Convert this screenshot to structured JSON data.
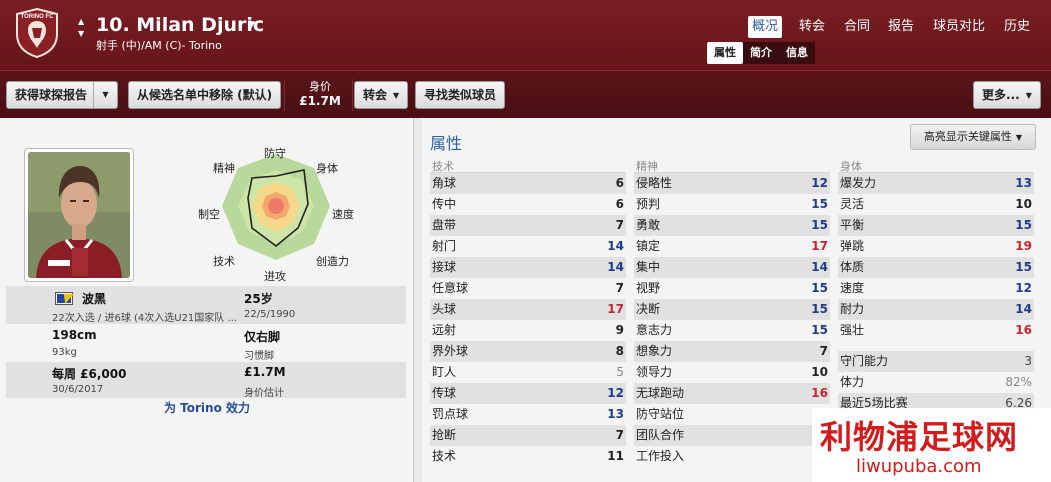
{
  "header": {
    "club_crest_text": "TORINO FC",
    "player_name": "10. Milan Djuric",
    "player_position": "射手 (中)/AM (C)- Torino",
    "nav": [
      "概况",
      "转会",
      "合同",
      "报告",
      "球员对比",
      "历史"
    ],
    "subnav": [
      "属性",
      "简介",
      "信息"
    ]
  },
  "toolbar": {
    "scout_report": "获得球探报告",
    "remove_shortlist": "从候选名单中移除 (默认)",
    "value_label": "身价",
    "value": "£1.7M",
    "transfer": "转会",
    "find_similar": "寻找类似球员",
    "more": "更多..."
  },
  "radar_labels": {
    "defending": "防守",
    "physical": "身体",
    "speed": "速度",
    "creativity": "创造力",
    "attacking": "进攻",
    "technique": "技术",
    "aerial": "制空",
    "mental": "精神"
  },
  "info": {
    "nation": "波黑",
    "caps": "22次入选 / 进6球 (4次入选U21国家队 ...",
    "age": "25岁",
    "dob": "22/5/1990",
    "height": "198cm",
    "weight": "93kg",
    "foot": "仅右脚",
    "foot_label": "习惯脚",
    "wage": "每周 £6,000",
    "contract_end": "30/6/2017",
    "value": "£1.7M",
    "value_label": "身价估计",
    "plays_for": "为 Torino 效力"
  },
  "attributes": {
    "title": "属性",
    "highlight_button": "高亮显示关键属性",
    "technical": {
      "label": "技术",
      "items": [
        {
          "name": "角球",
          "value": "6",
          "color": "dark"
        },
        {
          "name": "传中",
          "value": "6",
          "color": "dark"
        },
        {
          "name": "盘带",
          "value": "7",
          "color": "dark"
        },
        {
          "name": "射门",
          "value": "14",
          "color": "blue"
        },
        {
          "name": "接球",
          "value": "14",
          "color": "blue"
        },
        {
          "name": "任意球",
          "value": "7",
          "color": "dark"
        },
        {
          "name": "头球",
          "value": "17",
          "color": "red"
        },
        {
          "name": "远射",
          "value": "9",
          "color": "dark"
        },
        {
          "name": "界外球",
          "value": "8",
          "color": "dark"
        },
        {
          "name": "盯人",
          "value": "5",
          "color": "grey"
        },
        {
          "name": "传球",
          "value": "12",
          "color": "blue"
        },
        {
          "name": "罚点球",
          "value": "13",
          "color": "blue"
        },
        {
          "name": "抢断",
          "value": "7",
          "color": "dark"
        },
        {
          "name": "技术",
          "value": "11",
          "color": "dark"
        }
      ]
    },
    "mental": {
      "label": "精神",
      "items": [
        {
          "name": "侵略性",
          "value": "12",
          "color": "blue"
        },
        {
          "name": "预判",
          "value": "15",
          "color": "blue"
        },
        {
          "name": "勇敢",
          "value": "15",
          "color": "blue"
        },
        {
          "name": "镇定",
          "value": "17",
          "color": "red"
        },
        {
          "name": "集中",
          "value": "14",
          "color": "blue"
        },
        {
          "name": "视野",
          "value": "15",
          "color": "blue"
        },
        {
          "name": "决断",
          "value": "15",
          "color": "blue"
        },
        {
          "name": "意志力",
          "value": "15",
          "color": "blue"
        },
        {
          "name": "想象力",
          "value": "7",
          "color": "dark"
        },
        {
          "name": "领导力",
          "value": "10",
          "color": "dark"
        },
        {
          "name": "无球跑动",
          "value": "16",
          "color": "red"
        },
        {
          "name": "防守站位",
          "value": "",
          "color": "dark"
        },
        {
          "name": "团队合作",
          "value": "",
          "color": "dark"
        },
        {
          "name": "工作投入",
          "value": "",
          "color": "dark"
        }
      ]
    },
    "physical": {
      "label": "身体",
      "items": [
        {
          "name": "爆发力",
          "value": "13",
          "color": "blue"
        },
        {
          "name": "灵活",
          "value": "10",
          "color": "dark"
        },
        {
          "name": "平衡",
          "value": "15",
          "color": "blue"
        },
        {
          "name": "弹跳",
          "value": "19",
          "color": "red"
        },
        {
          "name": "体质",
          "value": "15",
          "color": "blue"
        },
        {
          "name": "速度",
          "value": "12",
          "color": "blue"
        },
        {
          "name": "耐力",
          "value": "14",
          "color": "blue"
        },
        {
          "name": "强壮",
          "value": "16",
          "color": "red"
        }
      ]
    },
    "extra": [
      {
        "name": "守门能力",
        "value": "3",
        "color": "lite"
      },
      {
        "name": "体力",
        "value": "82%",
        "color": "grey"
      },
      {
        "name": "最近5场比赛",
        "value": "6.26",
        "color": "lite"
      }
    ]
  },
  "watermark": {
    "cn": "利物浦足球网",
    "en": "liwupuba.com"
  },
  "colors": {
    "header_bg": "#6f1a20",
    "accent_blue": "#2c5fa6",
    "value_red": "#c8242c",
    "value_blue": "#1f3d8a"
  }
}
